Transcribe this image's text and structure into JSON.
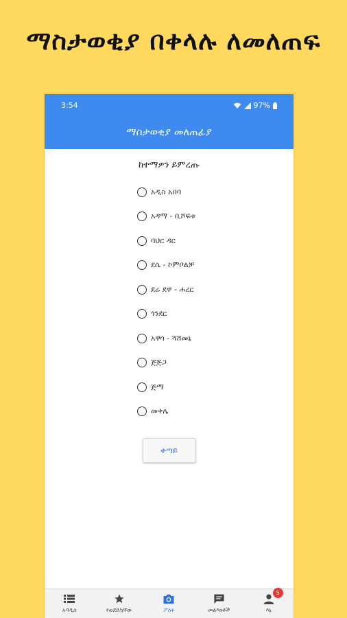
{
  "promo_title": "ማስታወቂያ በቀላሉ ለመለጠፍ",
  "status_bar": {
    "time": "3:54",
    "battery": "97%"
  },
  "app_bar": {
    "title": "ማስታወቂያ መለጠፊያ"
  },
  "prompt": "ከተማዎን ይምረጡ",
  "options": [
    {
      "label": "አዲስ አበባ"
    },
    {
      "label": "አዳማ - ቢሾፍቱ"
    },
    {
      "label": "ባህር ዳር"
    },
    {
      "label": "ደሴ - ኮምቦልቻ"
    },
    {
      "label": "ደሬ ደዋ - ሐረር"
    },
    {
      "label": "ጎንደር"
    },
    {
      "label": "አዋሳ - ሻሸመኔ"
    },
    {
      "label": "ጅጅጋ"
    },
    {
      "label": "ጅማ"
    },
    {
      "label": "መቀሌ"
    }
  ],
  "next_button": "ቀጣይ",
  "bottom_nav": [
    {
      "label": "አዳዲስ",
      "icon": "list-icon"
    },
    {
      "label": "የወደድኳቸው",
      "icon": "star-icon"
    },
    {
      "label": "ፖስት",
      "icon": "camera-icon",
      "active": true
    },
    {
      "label": "መልእክቶች",
      "icon": "message-icon"
    },
    {
      "label": "እኔ",
      "icon": "account-icon",
      "badge": "5"
    }
  ],
  "colors": {
    "background": "#FFD85E",
    "primary": "#3E8AEF",
    "active_nav": "#2F73D8",
    "badge": "#E53935"
  }
}
